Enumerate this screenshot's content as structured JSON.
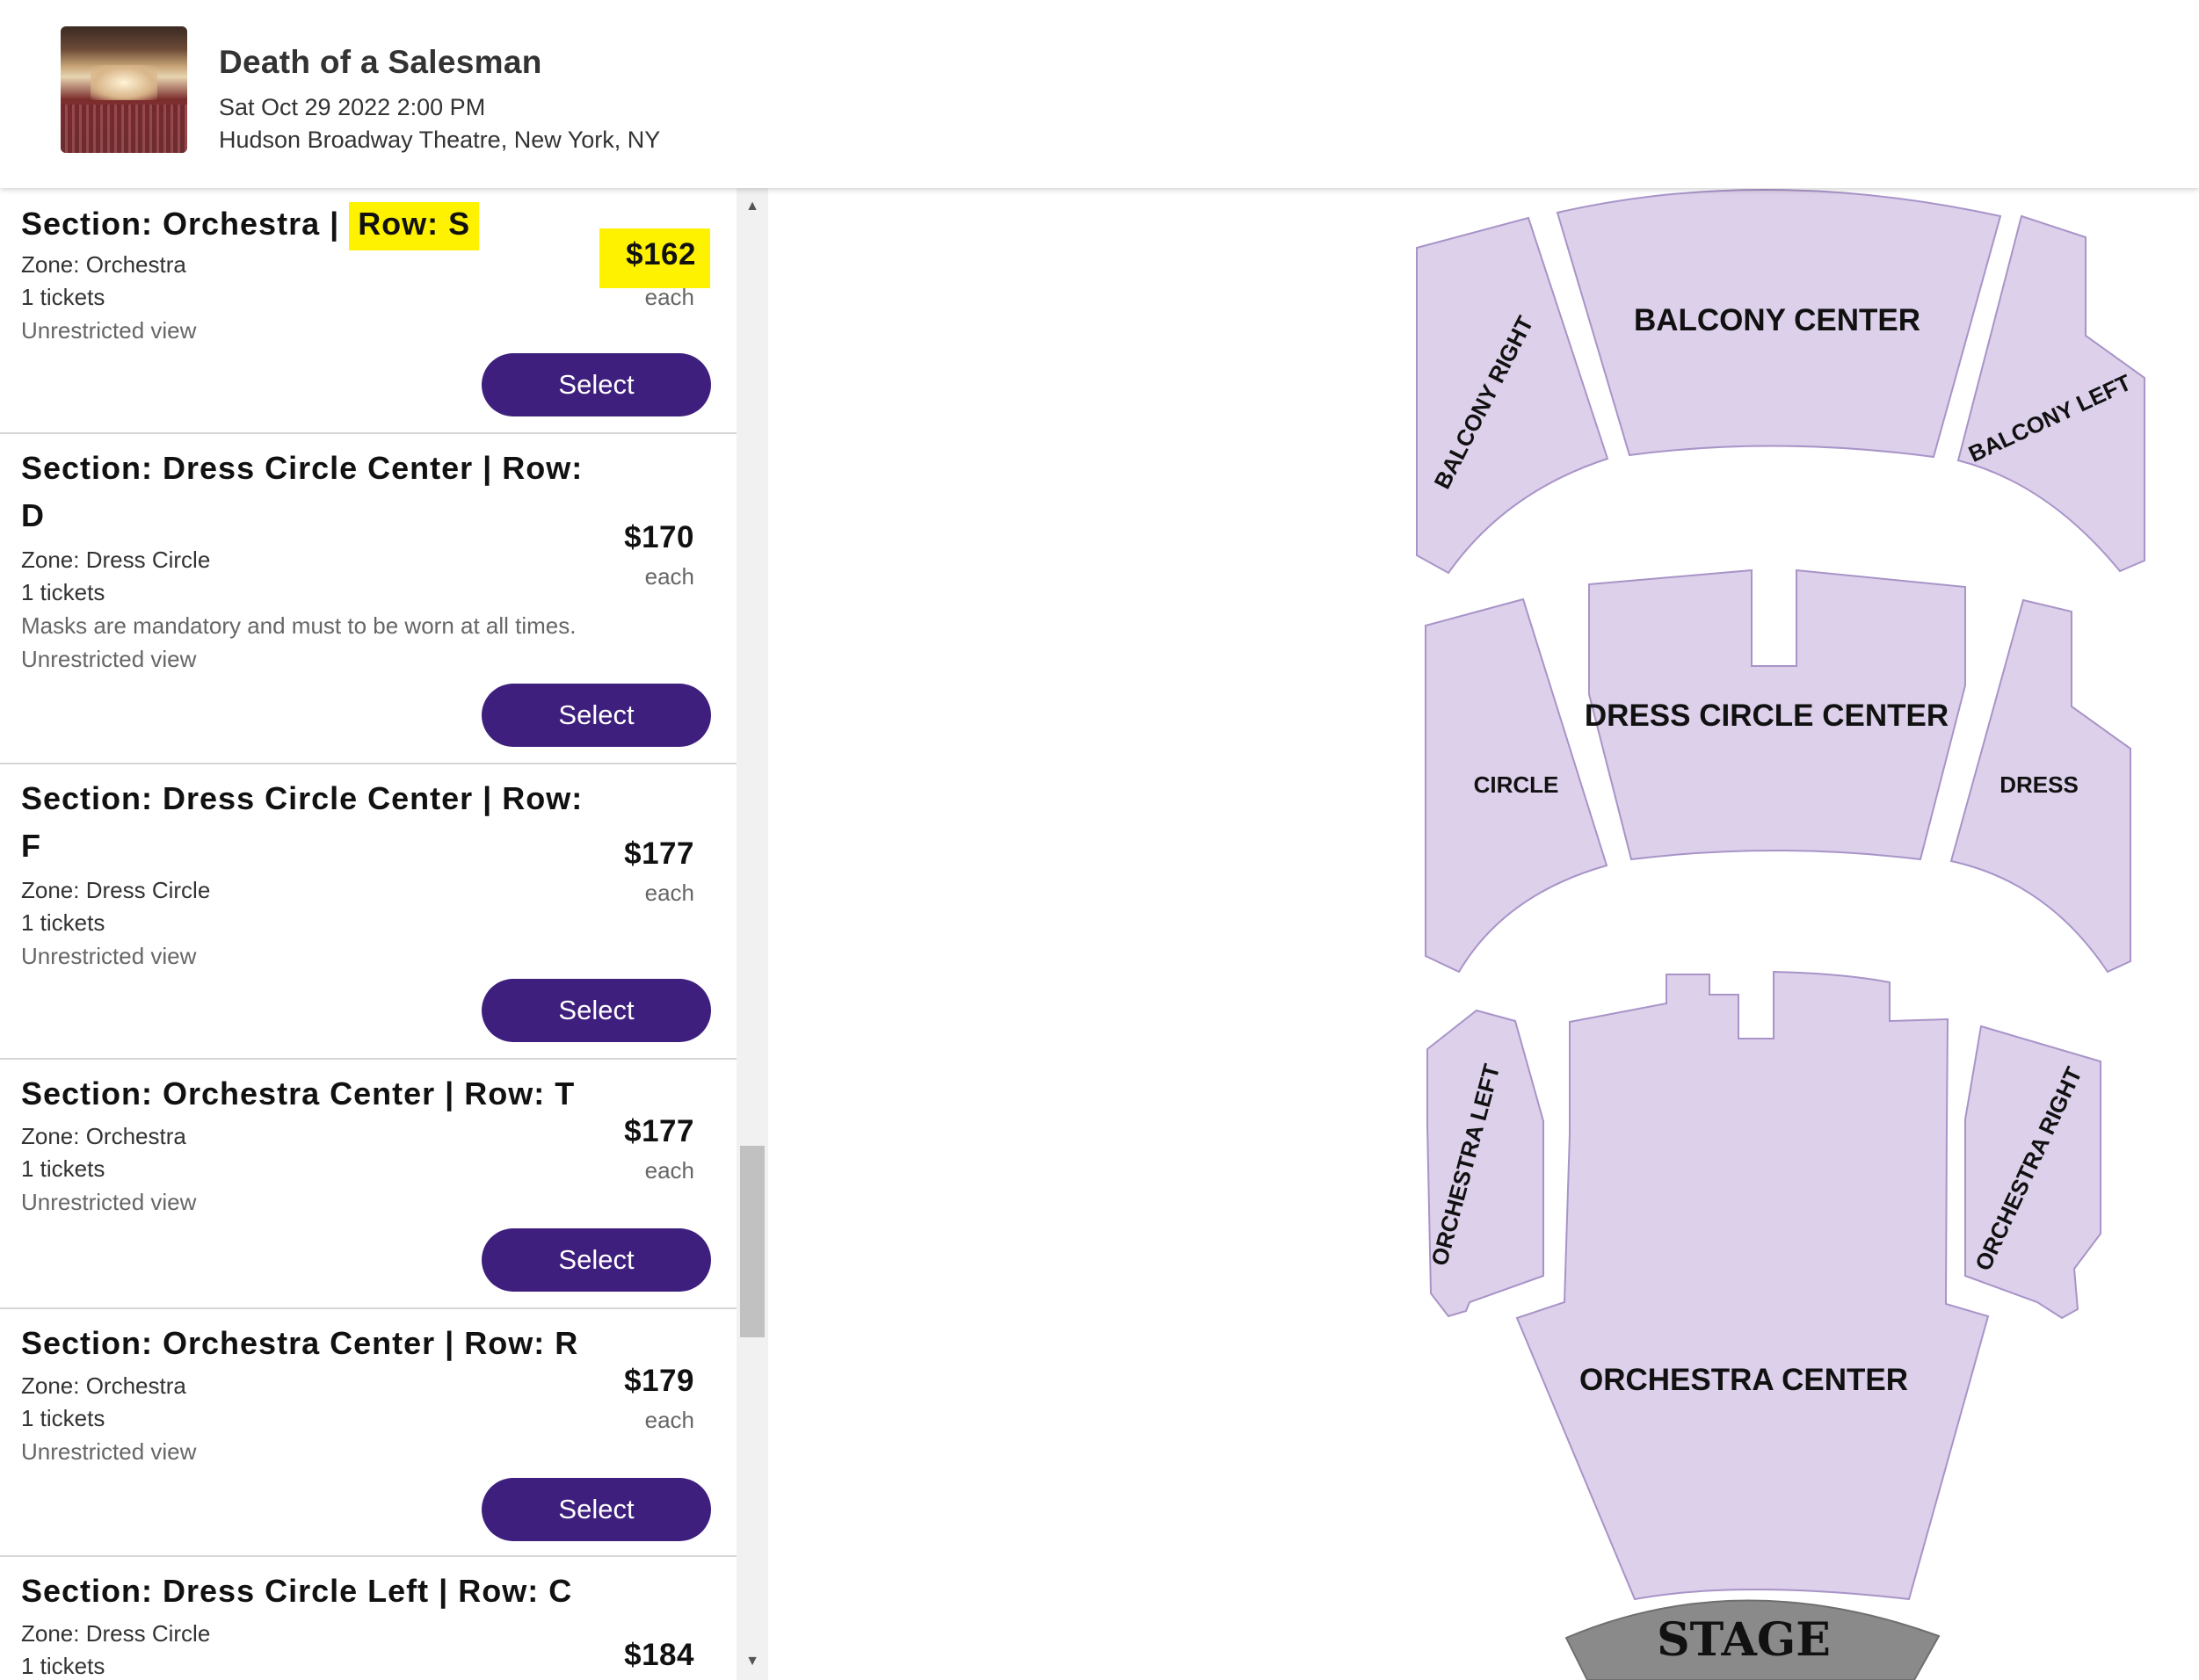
{
  "event": {
    "title": "Death of a Salesman",
    "datetime": "Sat Oct 29 2022 2:00 PM",
    "venue": "Hudson Broadway Theatre, New York, NY"
  },
  "listings": [
    {
      "title_prefix": "Section: Orchestra | ",
      "title_highlight": "Row: S",
      "zone": "Zone: Orchestra",
      "tickets": "1 tickets",
      "view": "Unrestricted view",
      "price": "$162",
      "each": "each",
      "button": "Select"
    },
    {
      "title_line1": "Section: Dress Circle Center | Row:",
      "title_line2": "D",
      "zone": "Zone: Dress Circle",
      "tickets": "1 tickets",
      "note": "Masks are mandatory and must to be worn at all times.",
      "view": "Unrestricted view",
      "price": "$170",
      "each": "each",
      "button": "Select"
    },
    {
      "title_line1": "Section: Dress Circle Center | Row:",
      "title_line2": "F",
      "zone": "Zone: Dress Circle",
      "tickets": "1 tickets",
      "view": "Unrestricted view",
      "price": "$177",
      "each": "each",
      "button": "Select"
    },
    {
      "title": "Section: Orchestra Center | Row: T",
      "zone": "Zone: Orchestra",
      "tickets": "1 tickets",
      "view": "Unrestricted view",
      "price": "$177",
      "each": "each",
      "button": "Select"
    },
    {
      "title": "Section: Orchestra Center | Row: R",
      "zone": "Zone: Orchestra",
      "tickets": "1 tickets",
      "view": "Unrestricted view",
      "price": "$179",
      "each": "each",
      "button": "Select"
    },
    {
      "title": "Section: Dress Circle Left | Row: C",
      "zone": "Zone: Dress Circle",
      "tickets": "1 tickets",
      "price": "$184"
    }
  ],
  "seatmap": {
    "sections": {
      "balcony_center": "BALCONY CENTER",
      "balcony_right": "BALCONY RIGHT",
      "balcony_left": "BALCONY LEFT",
      "dress_circle_center": "DRESS CIRCLE CENTER",
      "circle": "CIRCLE",
      "dress": "DRESS",
      "orchestra_left": "ORCHESTRA LEFT",
      "orchestra_right": "ORCHESTRA RIGHT",
      "orchestra_center": "ORCHESTRA CENTER",
      "stage": "STAGE"
    },
    "colors": {
      "section_fill": "#dcd0ea",
      "section_stroke": "#a894c8",
      "stage_fill": "#8a8a8a",
      "button": "#3e1f7d",
      "highlight": "#fff200"
    }
  }
}
